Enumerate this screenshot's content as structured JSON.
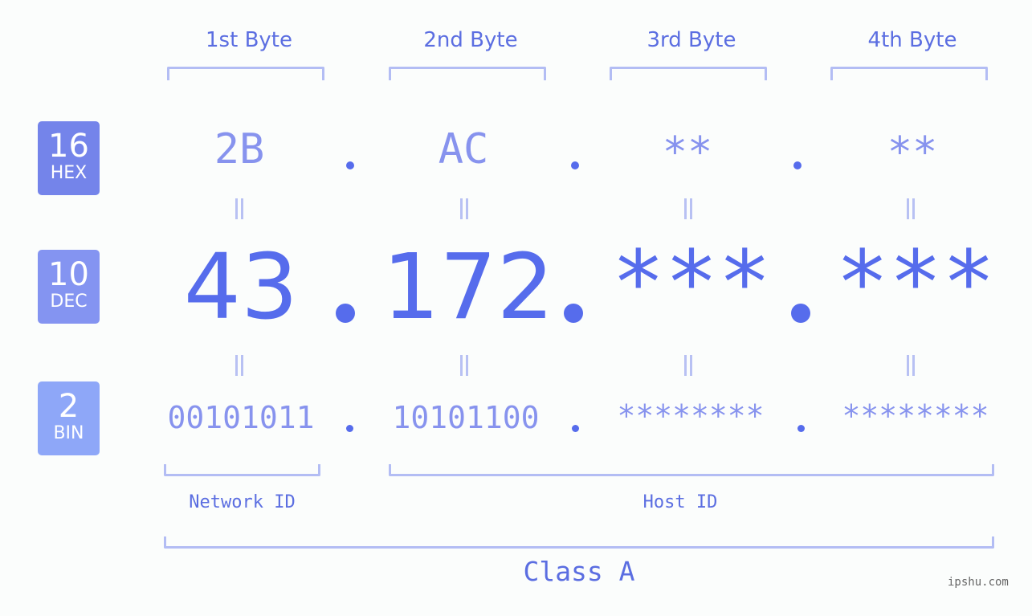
{
  "badges": [
    {
      "base": "16",
      "label": "HEX",
      "color": "#7484ea"
    },
    {
      "base": "10",
      "label": "DEC",
      "color": "#8494f1"
    },
    {
      "base": "2",
      "label": "BIN",
      "color": "#8ea7f8"
    }
  ],
  "bytes": [
    {
      "header": "1st Byte",
      "hex": "2B",
      "dec": "43",
      "bin": "00101011"
    },
    {
      "header": "2nd Byte",
      "hex": "AC",
      "dec": "172",
      "bin": "10101100"
    },
    {
      "header": "3rd Byte",
      "hex": "**",
      "dec": "***",
      "bin": "********"
    },
    {
      "header": "4th Byte",
      "hex": "**",
      "dec": "***",
      "bin": "********"
    }
  ],
  "segments": {
    "network": "Network ID",
    "host": "Host ID"
  },
  "ip_class": "Class A",
  "watermark": "ipshu.com",
  "colors": {
    "primary": "#566cec",
    "light": "#8793ee",
    "bracket": "#b3bdf4",
    "background": "#fbfdfc"
  }
}
